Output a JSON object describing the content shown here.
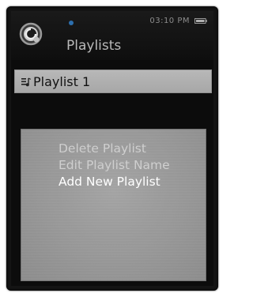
{
  "status_bar": {
    "time": "03:10 PM"
  },
  "header": {
    "title": "Playlists"
  },
  "playlist_list": {
    "items": [
      {
        "label": "Playlist 1"
      }
    ]
  },
  "context_menu": {
    "items": [
      {
        "label": "Delete Playlist",
        "state": "dimmed"
      },
      {
        "label": "Edit Playlist Name",
        "state": "dimmed"
      },
      {
        "label": "Add New Playlist",
        "state": "highlighted"
      }
    ]
  },
  "icons": {
    "app": "media-player-icon",
    "status": "bluetooth-dot-icon",
    "battery": "battery-icon",
    "playlist": "playlist-icon"
  },
  "colors": {
    "menu_highlight": "#ffffff",
    "menu_dimmed": "#cfcfcf",
    "selected_row": "#b0b0b0"
  }
}
